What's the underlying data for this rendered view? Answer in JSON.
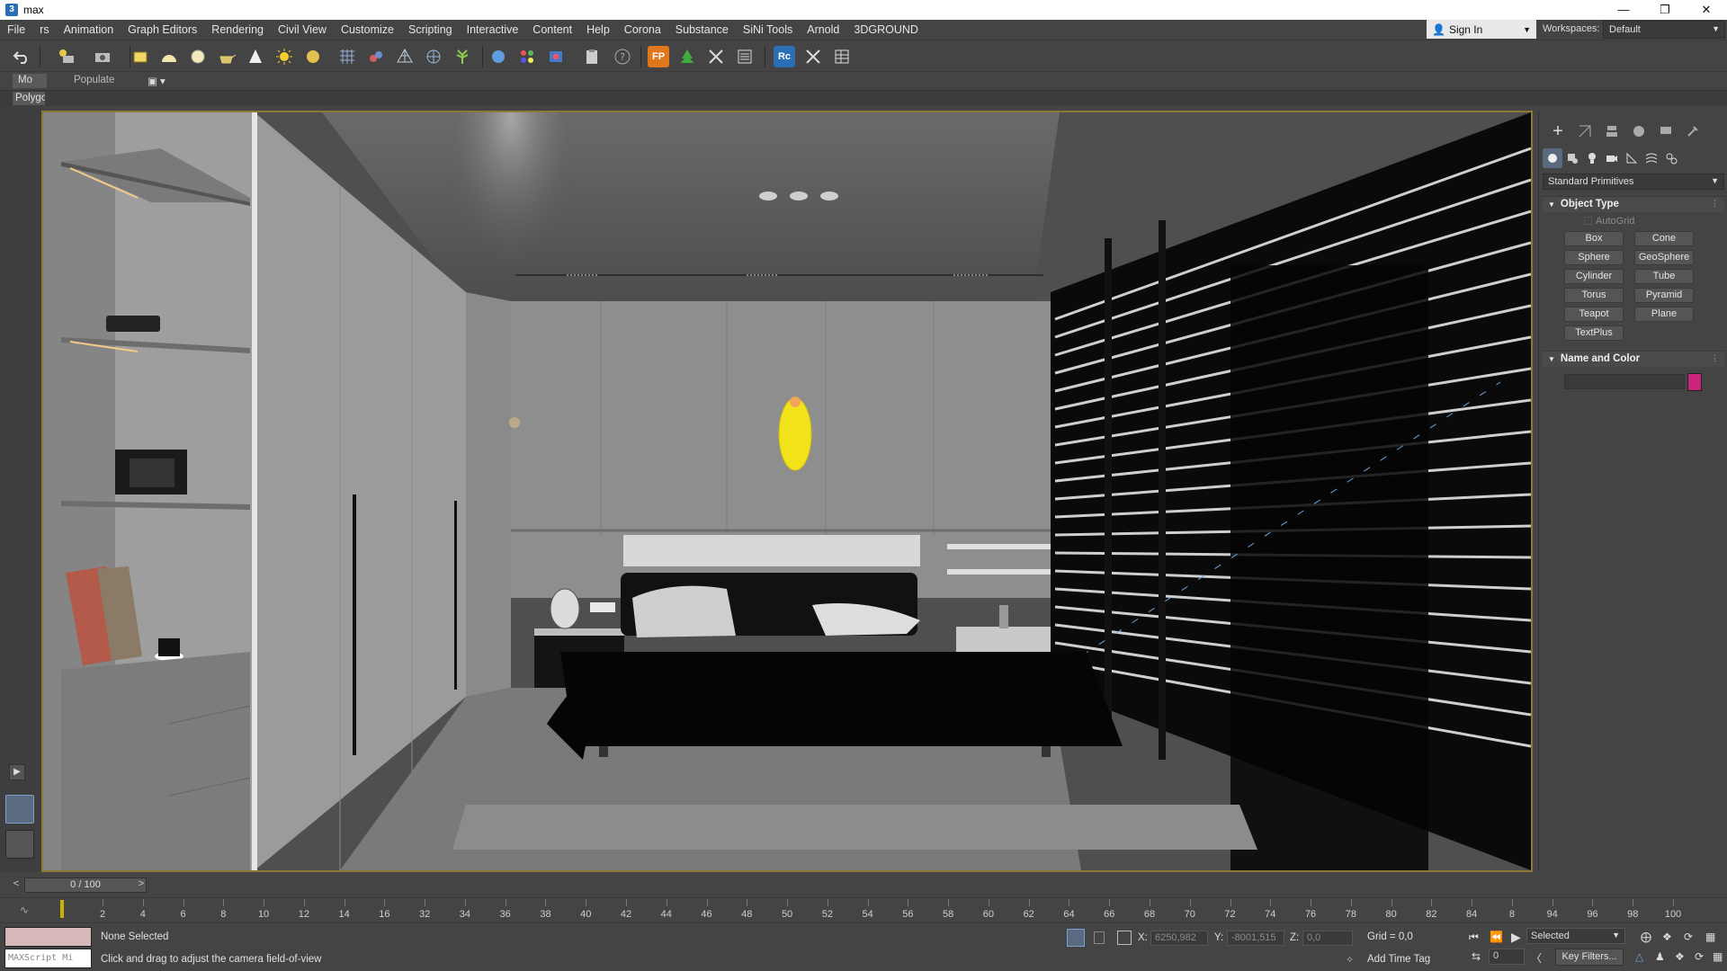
{
  "window": {
    "title": "max",
    "controls": [
      "—",
      "❐",
      "✕"
    ]
  },
  "menu": [
    "File",
    "rs",
    "Animation",
    "Graph Editors",
    "Rendering",
    "Civil View",
    "Customize",
    "Scripting",
    "Interactive",
    "Content",
    "Help",
    "Corona",
    "Substance",
    "SiNi Tools",
    "Arnold",
    "3DGROUND"
  ],
  "account": {
    "sign_in_label": "Sign In",
    "workspaces_label": "Workspaces:",
    "workspace_value": "Default"
  },
  "ribbon": {
    "tab_active": "Mo",
    "tab_populate": "Populate",
    "sub_tab": "Polygo"
  },
  "command_panel": {
    "dropdown": "Standard Primitives",
    "rollout_object_type": "Object Type",
    "autogrid_label": "AutoGrid",
    "primitives": [
      "Box",
      "Cone",
      "Sphere",
      "GeoSphere",
      "Cylinder",
      "Tube",
      "Torus",
      "Pyramid",
      "Teapot",
      "Plane",
      "TextPlus"
    ],
    "rollout_name_color": "Name and Color",
    "object_color": "#c8267a"
  },
  "time_slider": {
    "label": "0 / 100",
    "current_frame": 0,
    "total_frames": 100
  },
  "trackbar": {
    "ticks": [
      "2",
      "4",
      "6",
      "8",
      "10",
      "12",
      "14",
      "16",
      "32",
      "34",
      "36",
      "38",
      "40",
      "42",
      "44",
      "46",
      "48",
      "50",
      "52",
      "54",
      "56",
      "58",
      "60",
      "62",
      "64",
      "66",
      "68",
      "70",
      "72",
      "74",
      "76",
      "78",
      "80",
      "82",
      "84",
      "8",
      "94",
      "96",
      "98",
      "100"
    ]
  },
  "status": {
    "maxscript_placeholder": "MAXScript Mi",
    "selection": "None Selected",
    "prompt": "Click and drag to adjust the camera field-of-view",
    "x_label": "X:",
    "x_value": "6250,982",
    "y_label": "Y:",
    "y_value": "-8001,515",
    "z_label": "Z:",
    "z_value": "0,0",
    "grid": "Grid = 0,0",
    "add_time_tag": "Add Time Tag",
    "selected_dropdown": "Selected",
    "frame_value": "0",
    "key_filters": "Key Filters..."
  },
  "colors": {
    "viewport_border": "#8a7a36",
    "accent_yellow": "#c8b400",
    "lamp": "#f2e21a"
  }
}
